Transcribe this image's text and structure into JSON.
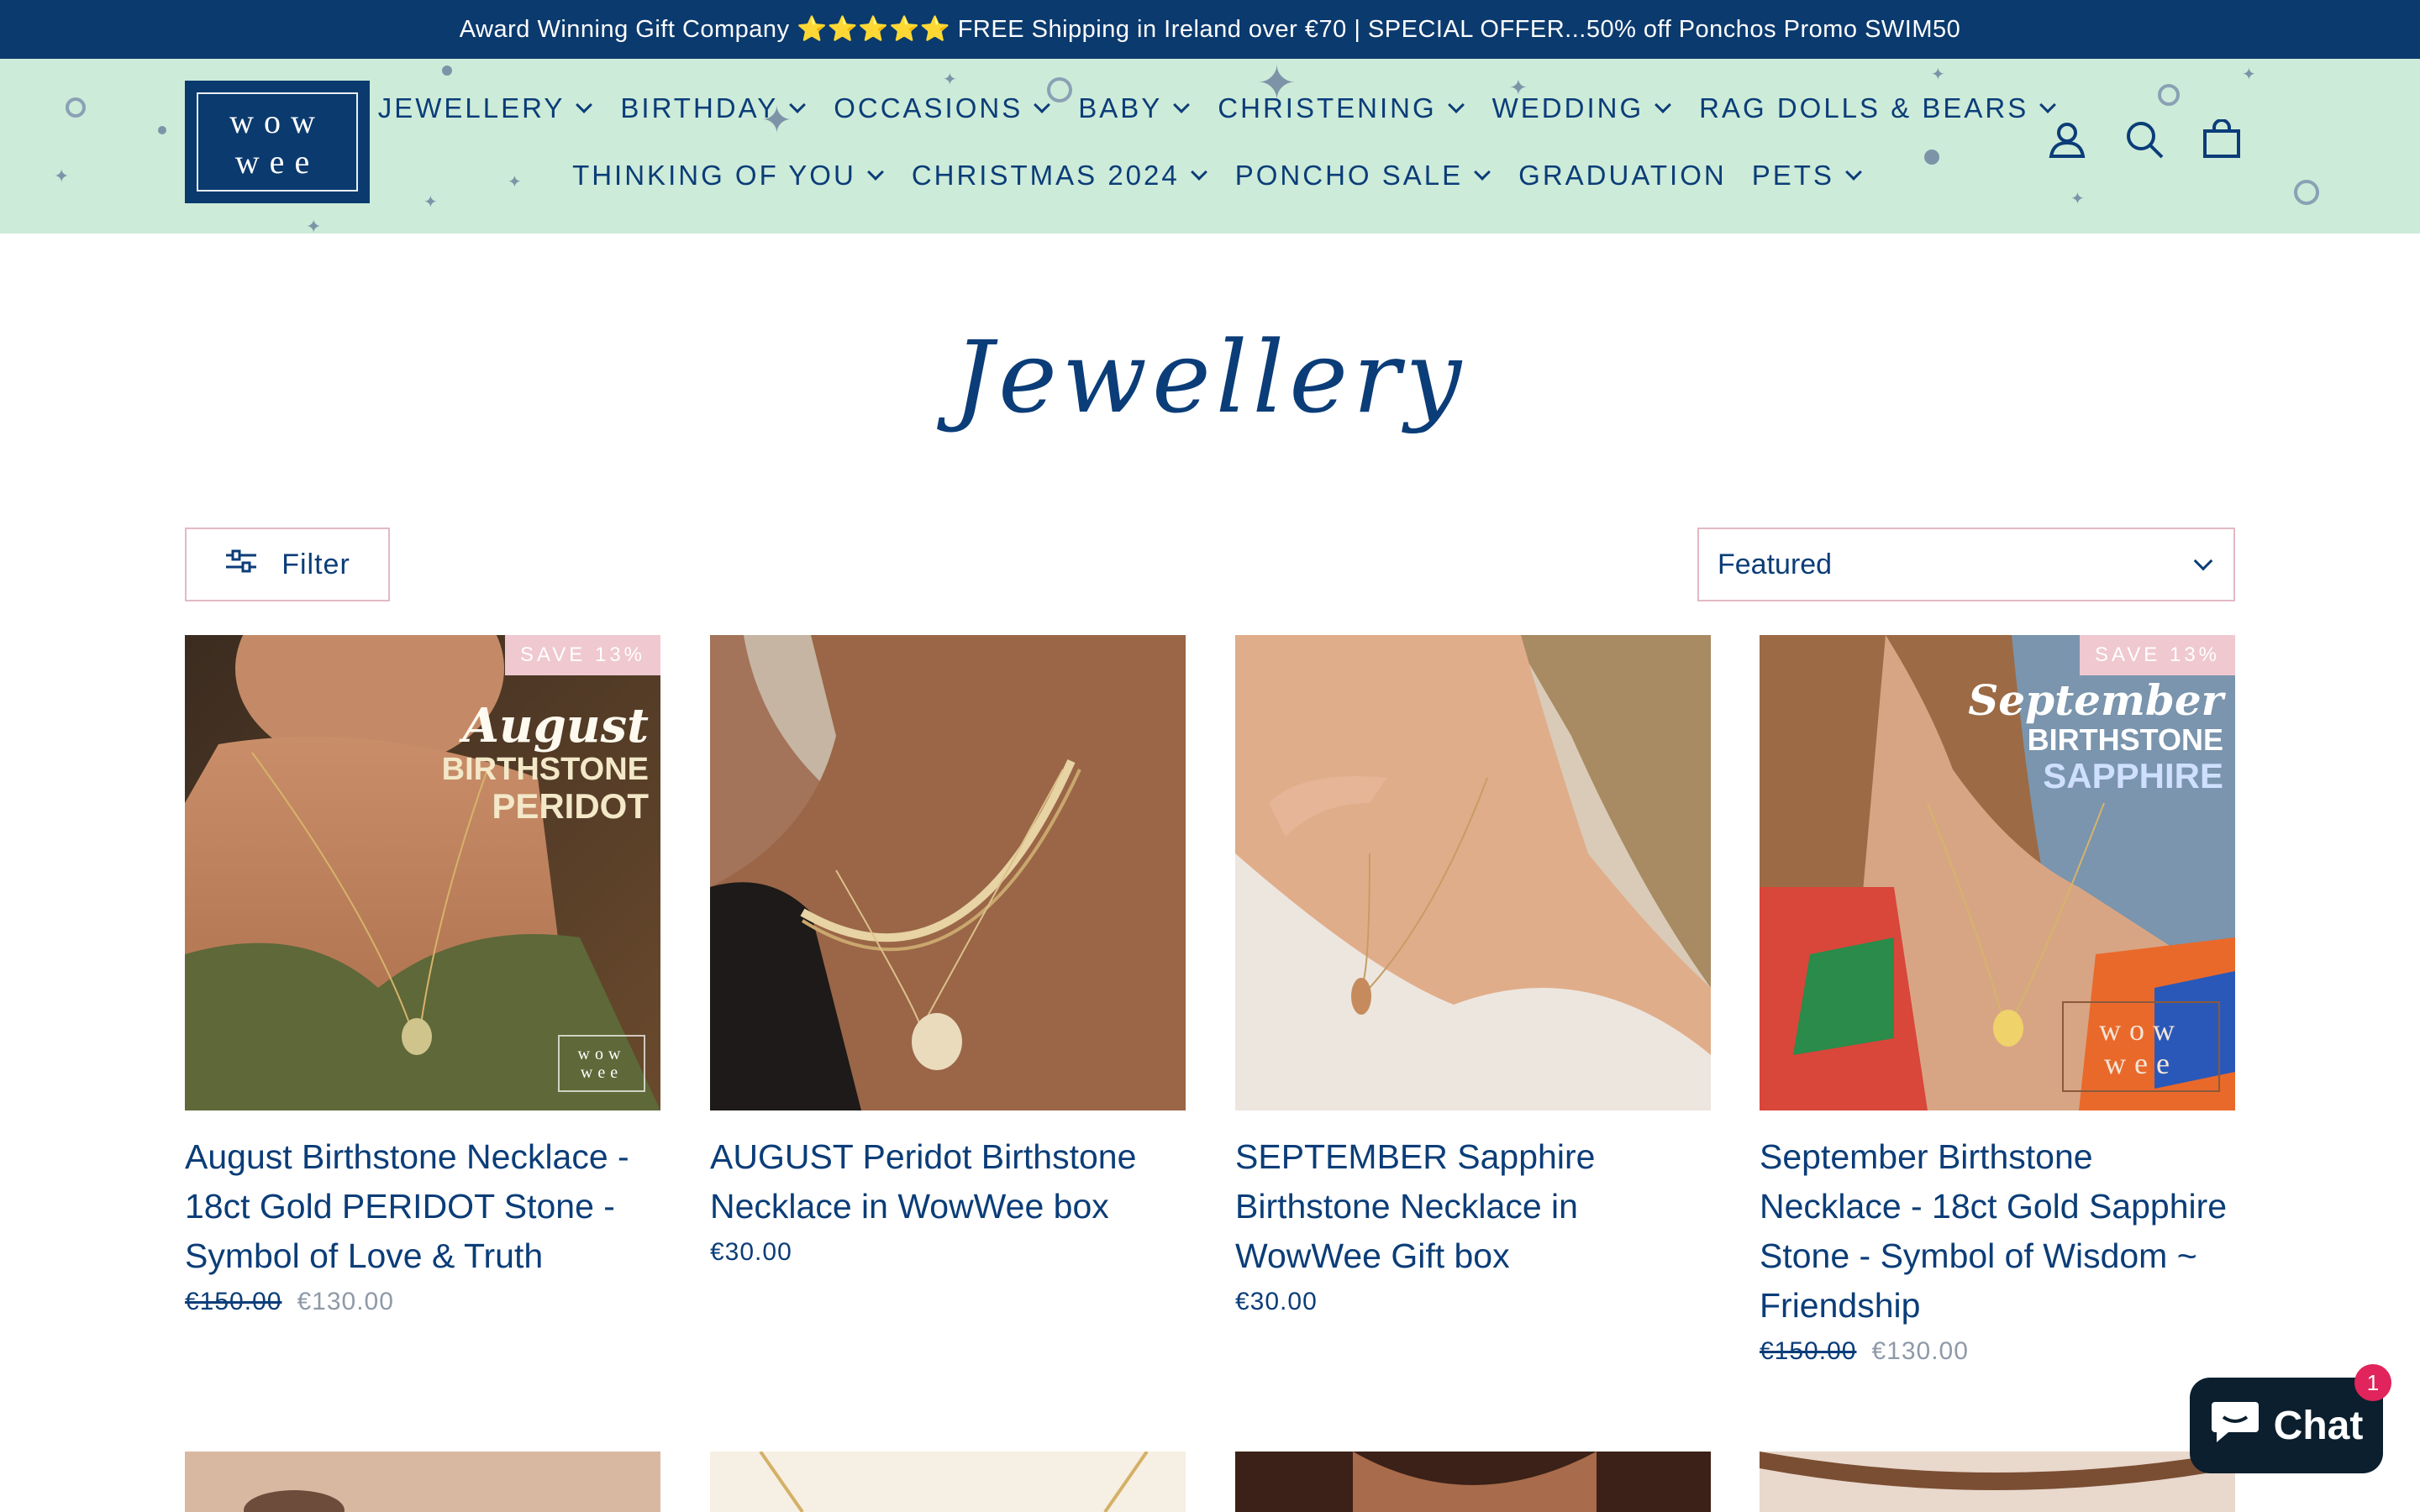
{
  "announcement": {
    "text": "Award Winning Gift Company ⭐⭐⭐⭐⭐ FREE Shipping in Ireland over €70 | SPECIAL OFFER...50% off Ponchos Promo SWIM50"
  },
  "header": {
    "logo": {
      "line1": "wow",
      "line2": "wee"
    },
    "nav_row1": [
      {
        "label": "JEWELLERY",
        "dropdown": true
      },
      {
        "label": "BIRTHDAY",
        "dropdown": true
      },
      {
        "label": "OCCASIONS",
        "dropdown": true
      },
      {
        "label": "BABY",
        "dropdown": true
      },
      {
        "label": "CHRISTENING",
        "dropdown": true
      },
      {
        "label": "WEDDING",
        "dropdown": true
      },
      {
        "label": "RAG DOLLS & BEARS",
        "dropdown": true
      }
    ],
    "nav_row2": [
      {
        "label": "THINKING OF YOU",
        "dropdown": true
      },
      {
        "label": "CHRISTMAS 2024",
        "dropdown": true
      },
      {
        "label": "PONCHO SALE",
        "dropdown": true
      },
      {
        "label": "GRADUATION",
        "dropdown": false
      },
      {
        "label": "PETS",
        "dropdown": true
      }
    ],
    "icons": [
      "account-icon",
      "search-icon",
      "cart-icon"
    ]
  },
  "collection": {
    "title": "Jewellery"
  },
  "toolbar": {
    "filter_label": "Filter",
    "sort_selected": "Featured"
  },
  "products": [
    {
      "title": "August Birthstone Necklace - 18ct Gold PERIDOT Stone - Symbol of Love & Truth",
      "price_old": "€150.00",
      "price_new": "€130.00",
      "badge": "SAVE 13%",
      "image_text": {
        "month": "August",
        "line1": "BIRTHSTONE",
        "line2": "PERIDOT"
      },
      "image_logo": {
        "line1": "wow",
        "line2": "wee"
      }
    },
    {
      "title": "AUGUST Peridot Birthstone Necklace in WowWee box",
      "price": "€30.00"
    },
    {
      "title": "SEPTEMBER Sapphire Birthstone Necklace in WowWee Gift box",
      "price": "€30.00"
    },
    {
      "title": "September Birthstone Necklace - 18ct Gold Sapphire Stone - Symbol of Wisdom ~ Friendship",
      "price_old": "€150.00",
      "price_new": "€130.00",
      "badge": "SAVE 13%",
      "image_text": {
        "month": "September",
        "line1": "BIRTHSTONE",
        "line2": "SAPPHIRE"
      },
      "image_logo": {
        "line1": "wow",
        "line2": "wee"
      }
    }
  ],
  "chat": {
    "label": "Chat",
    "badge_count": "1"
  },
  "colors": {
    "brand_navy": "#0b3a6e",
    "header_mint": "#cdebd9",
    "badge_pink": "#efc8d0",
    "chat_dark": "#0b1f2e",
    "chat_badge": "#e1245b"
  }
}
